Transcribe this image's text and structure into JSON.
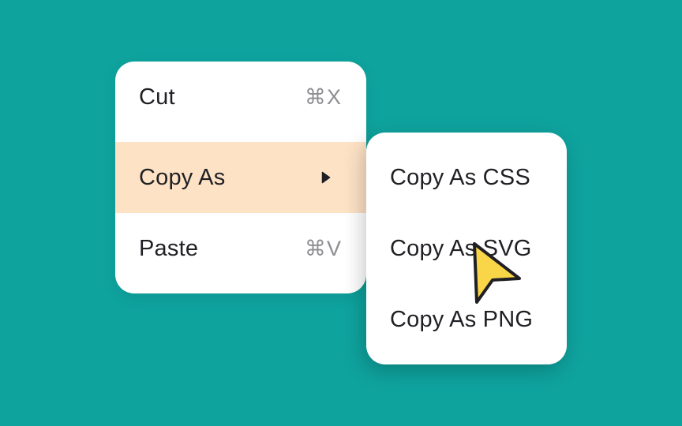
{
  "main_menu": {
    "items": [
      {
        "label": "Cut",
        "shortcut": "⌘X"
      },
      {
        "label": "Copy As",
        "submenu_icon": "chevron-right-icon"
      },
      {
        "label": "Paste",
        "shortcut": "⌘V"
      }
    ],
    "highlighted_index": 1
  },
  "submenu": {
    "items": [
      {
        "label": "Copy As CSS"
      },
      {
        "label": "Copy As SVG"
      },
      {
        "label": "Copy As PNG"
      }
    ]
  },
  "cursor": {
    "icon": "pointer-cursor-icon",
    "color": "#f9d648"
  },
  "colors": {
    "background": "#0fa39e",
    "menu": "#ffffff",
    "highlight": "#fde2c5",
    "text": "#1f1f24",
    "shortcut_text": "#8e8e93"
  }
}
